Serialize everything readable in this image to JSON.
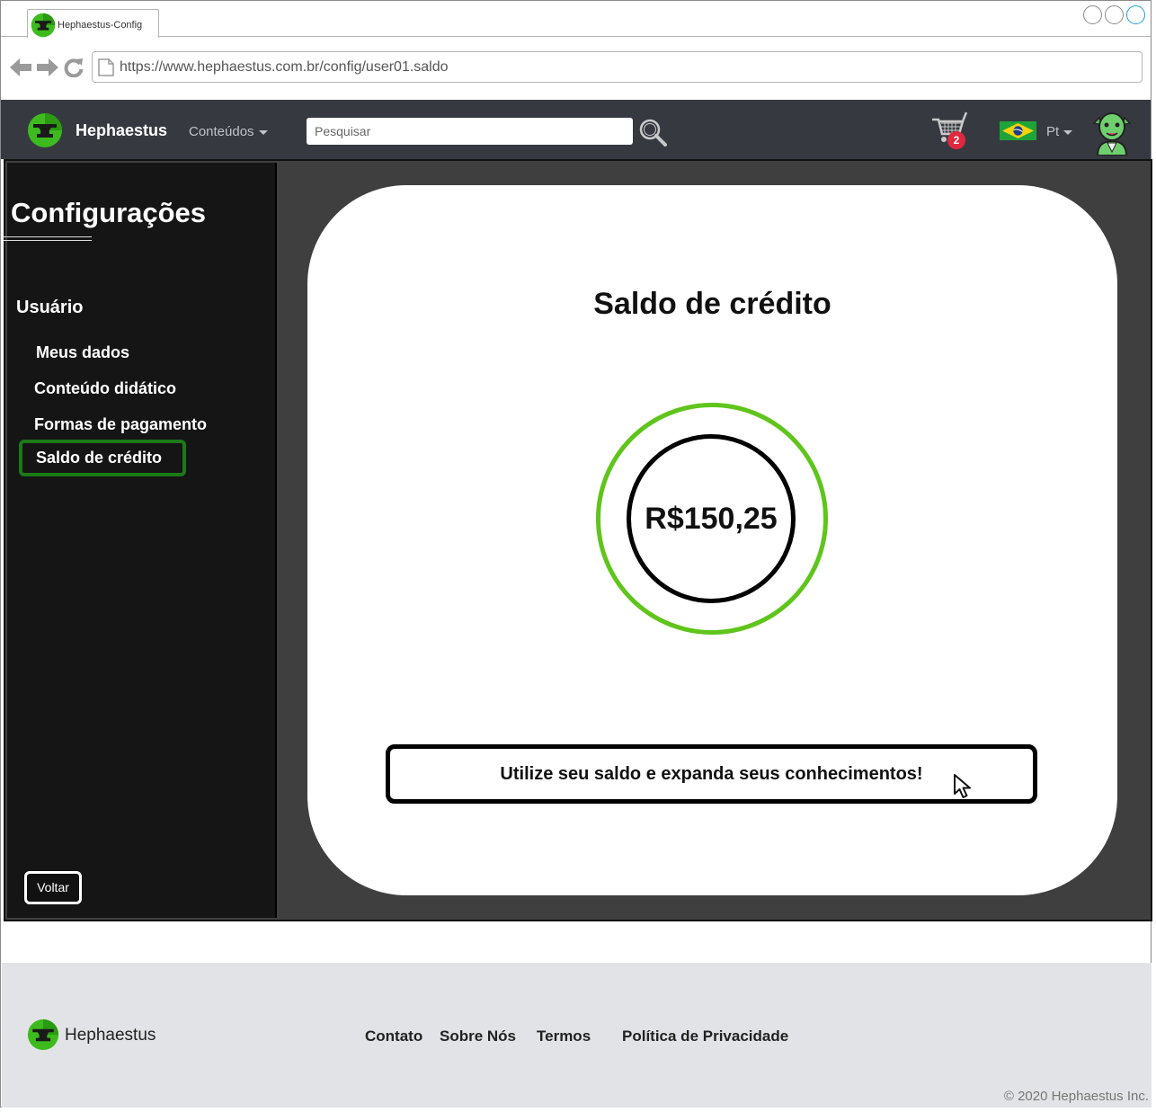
{
  "browser": {
    "tab_title": "Hephaestus-Config",
    "url": "https://www.hephaestus.com.br/config/user01.saldo"
  },
  "header": {
    "brand": "Hephaestus",
    "contents_menu": "Conteúdos",
    "search_placeholder": "Pesquisar",
    "cart_count": "2",
    "language": "Pt"
  },
  "sidebar": {
    "title": "Configurações",
    "section": "Usuário",
    "items": [
      {
        "label": "Meus dados"
      },
      {
        "label": "Conteúdo didático"
      },
      {
        "label": "Formas de pagamento"
      },
      {
        "label": "Saldo de crédito",
        "active": true
      }
    ],
    "back_label": "Voltar"
  },
  "main": {
    "title": "Saldo de crédito",
    "balance": "R$150,25",
    "cta_label": "Utilize seu saldo e expanda seus conhecimentos!"
  },
  "footer": {
    "brand": "Hephaestus",
    "links": [
      "Contato",
      "Sobre Nós",
      "Termos",
      "Política de Privacidade"
    ],
    "copyright": "© 2020 Hephaestus Inc."
  },
  "colors": {
    "header_bg": "#363a40",
    "sidebar_bg": "#151515",
    "accent_green": "#5fc51b",
    "active_border": "#1b7a16",
    "badge_red": "#e0283e"
  },
  "icons": [
    "anvil-logo-icon",
    "back-arrow-icon",
    "forward-arrow-icon",
    "reload-icon",
    "document-icon",
    "search-icon",
    "cart-icon",
    "brazil-flag-icon",
    "avatar-icon",
    "cursor-icon"
  ]
}
